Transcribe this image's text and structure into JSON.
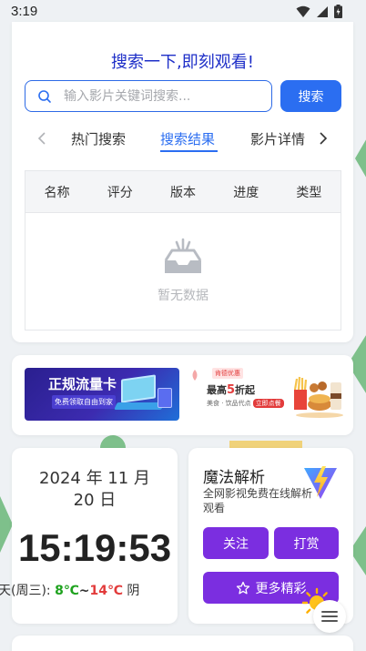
{
  "status_bar": {
    "time": "3:19"
  },
  "search": {
    "headline": "搜索一下,即刻观看!",
    "placeholder": "输入影片关键词搜索...",
    "value": "",
    "button_label": "搜索"
  },
  "tabs": {
    "items": [
      {
        "label": "热门搜索",
        "active": false
      },
      {
        "label": "搜索结果",
        "active": true
      },
      {
        "label": "影片详情",
        "active": false
      }
    ]
  },
  "results_table": {
    "columns": [
      "名称",
      "评分",
      "版本",
      "进度",
      "类型"
    ],
    "rows": [],
    "empty_text": "暂无数据"
  },
  "banners": {
    "left": {
      "title": "正规流量卡",
      "subtitle": "免费领取自由到家"
    },
    "right": {
      "tag": "肯德优惠",
      "text_prefix": "最高",
      "text_num": "5",
      "text_suffix": "折起",
      "line2": "美食 · 饮品代点",
      "cta": "立即点餐"
    }
  },
  "datetime": {
    "date_line1": "2024 年 11 月",
    "date_line2": "20 日",
    "time": "15:19:53",
    "weather_prefix": "天(周三):",
    "temp_low": "8℃",
    "temp_sep": "~",
    "temp_high": "14℃",
    "condition": "阴"
  },
  "magic": {
    "title": "魔法解析",
    "description": "全网影视免费在线解析观看",
    "follow_label": "关注",
    "tip_label": "打赏",
    "more_label": "更多精彩"
  },
  "colors": {
    "accent_blue": "#2b6ef1",
    "headline_blue": "#1e2fc8",
    "purple": "#7b2ee0",
    "temp_low": "#1ea21e",
    "temp_high": "#e23b3b"
  }
}
